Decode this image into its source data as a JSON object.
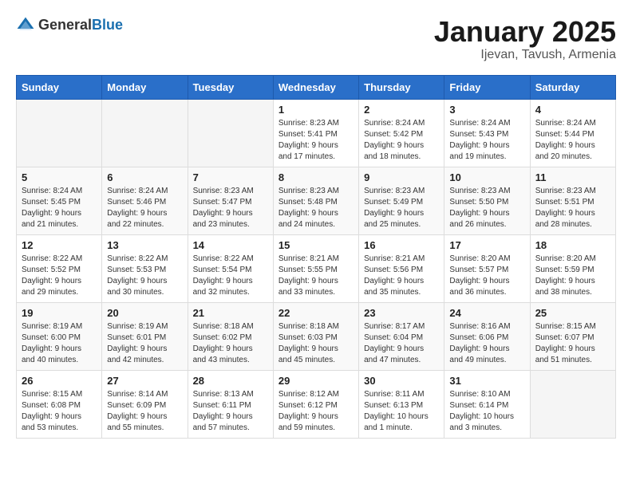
{
  "header": {
    "logo_general": "General",
    "logo_blue": "Blue",
    "title": "January 2025",
    "subtitle": "Ijevan, Tavush, Armenia"
  },
  "days_of_week": [
    "Sunday",
    "Monday",
    "Tuesday",
    "Wednesday",
    "Thursday",
    "Friday",
    "Saturday"
  ],
  "weeks": [
    [
      {
        "day": "",
        "info": ""
      },
      {
        "day": "",
        "info": ""
      },
      {
        "day": "",
        "info": ""
      },
      {
        "day": "1",
        "info": "Sunrise: 8:23 AM\nSunset: 5:41 PM\nDaylight: 9 hours\nand 17 minutes."
      },
      {
        "day": "2",
        "info": "Sunrise: 8:24 AM\nSunset: 5:42 PM\nDaylight: 9 hours\nand 18 minutes."
      },
      {
        "day": "3",
        "info": "Sunrise: 8:24 AM\nSunset: 5:43 PM\nDaylight: 9 hours\nand 19 minutes."
      },
      {
        "day": "4",
        "info": "Sunrise: 8:24 AM\nSunset: 5:44 PM\nDaylight: 9 hours\nand 20 minutes."
      }
    ],
    [
      {
        "day": "5",
        "info": "Sunrise: 8:24 AM\nSunset: 5:45 PM\nDaylight: 9 hours\nand 21 minutes."
      },
      {
        "day": "6",
        "info": "Sunrise: 8:24 AM\nSunset: 5:46 PM\nDaylight: 9 hours\nand 22 minutes."
      },
      {
        "day": "7",
        "info": "Sunrise: 8:23 AM\nSunset: 5:47 PM\nDaylight: 9 hours\nand 23 minutes."
      },
      {
        "day": "8",
        "info": "Sunrise: 8:23 AM\nSunset: 5:48 PM\nDaylight: 9 hours\nand 24 minutes."
      },
      {
        "day": "9",
        "info": "Sunrise: 8:23 AM\nSunset: 5:49 PM\nDaylight: 9 hours\nand 25 minutes."
      },
      {
        "day": "10",
        "info": "Sunrise: 8:23 AM\nSunset: 5:50 PM\nDaylight: 9 hours\nand 26 minutes."
      },
      {
        "day": "11",
        "info": "Sunrise: 8:23 AM\nSunset: 5:51 PM\nDaylight: 9 hours\nand 28 minutes."
      }
    ],
    [
      {
        "day": "12",
        "info": "Sunrise: 8:22 AM\nSunset: 5:52 PM\nDaylight: 9 hours\nand 29 minutes."
      },
      {
        "day": "13",
        "info": "Sunrise: 8:22 AM\nSunset: 5:53 PM\nDaylight: 9 hours\nand 30 minutes."
      },
      {
        "day": "14",
        "info": "Sunrise: 8:22 AM\nSunset: 5:54 PM\nDaylight: 9 hours\nand 32 minutes."
      },
      {
        "day": "15",
        "info": "Sunrise: 8:21 AM\nSunset: 5:55 PM\nDaylight: 9 hours\nand 33 minutes."
      },
      {
        "day": "16",
        "info": "Sunrise: 8:21 AM\nSunset: 5:56 PM\nDaylight: 9 hours\nand 35 minutes."
      },
      {
        "day": "17",
        "info": "Sunrise: 8:20 AM\nSunset: 5:57 PM\nDaylight: 9 hours\nand 36 minutes."
      },
      {
        "day": "18",
        "info": "Sunrise: 8:20 AM\nSunset: 5:59 PM\nDaylight: 9 hours\nand 38 minutes."
      }
    ],
    [
      {
        "day": "19",
        "info": "Sunrise: 8:19 AM\nSunset: 6:00 PM\nDaylight: 9 hours\nand 40 minutes."
      },
      {
        "day": "20",
        "info": "Sunrise: 8:19 AM\nSunset: 6:01 PM\nDaylight: 9 hours\nand 42 minutes."
      },
      {
        "day": "21",
        "info": "Sunrise: 8:18 AM\nSunset: 6:02 PM\nDaylight: 9 hours\nand 43 minutes."
      },
      {
        "day": "22",
        "info": "Sunrise: 8:18 AM\nSunset: 6:03 PM\nDaylight: 9 hours\nand 45 minutes."
      },
      {
        "day": "23",
        "info": "Sunrise: 8:17 AM\nSunset: 6:04 PM\nDaylight: 9 hours\nand 47 minutes."
      },
      {
        "day": "24",
        "info": "Sunrise: 8:16 AM\nSunset: 6:06 PM\nDaylight: 9 hours\nand 49 minutes."
      },
      {
        "day": "25",
        "info": "Sunrise: 8:15 AM\nSunset: 6:07 PM\nDaylight: 9 hours\nand 51 minutes."
      }
    ],
    [
      {
        "day": "26",
        "info": "Sunrise: 8:15 AM\nSunset: 6:08 PM\nDaylight: 9 hours\nand 53 minutes."
      },
      {
        "day": "27",
        "info": "Sunrise: 8:14 AM\nSunset: 6:09 PM\nDaylight: 9 hours\nand 55 minutes."
      },
      {
        "day": "28",
        "info": "Sunrise: 8:13 AM\nSunset: 6:11 PM\nDaylight: 9 hours\nand 57 minutes."
      },
      {
        "day": "29",
        "info": "Sunrise: 8:12 AM\nSunset: 6:12 PM\nDaylight: 9 hours\nand 59 minutes."
      },
      {
        "day": "30",
        "info": "Sunrise: 8:11 AM\nSunset: 6:13 PM\nDaylight: 10 hours\nand 1 minute."
      },
      {
        "day": "31",
        "info": "Sunrise: 8:10 AM\nSunset: 6:14 PM\nDaylight: 10 hours\nand 3 minutes."
      },
      {
        "day": "",
        "info": ""
      }
    ]
  ]
}
